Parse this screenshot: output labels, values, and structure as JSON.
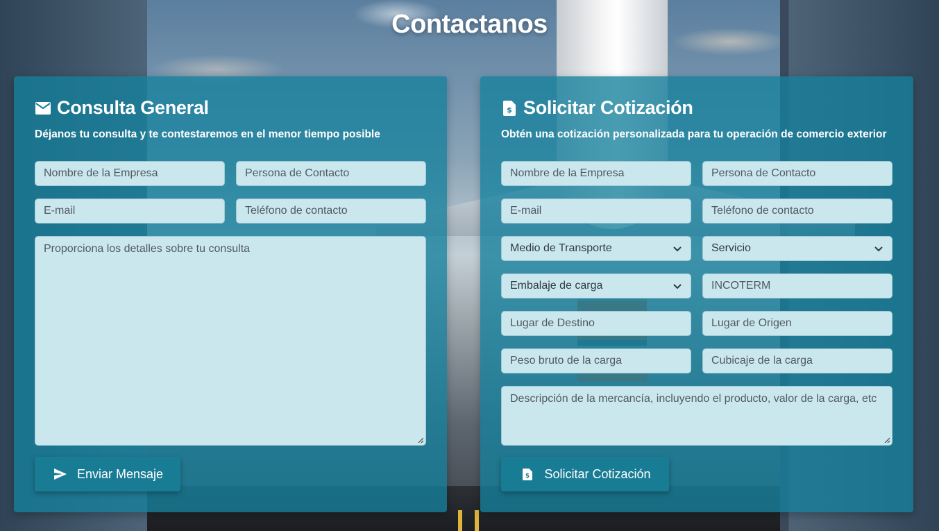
{
  "page": {
    "title": "Contactanos"
  },
  "colors": {
    "card_bg": "#15809c",
    "field_bg": "#cbe7ee",
    "button_bg": "#197c95"
  },
  "general": {
    "icon": "mail-icon",
    "title": "Consulta General",
    "subtitle": "Déjanos tu consulta y te contestaremos en el menor tiempo posible",
    "fields": {
      "company_placeholder": "Nombre de la Empresa",
      "contact_placeholder": "Persona de Contacto",
      "email_placeholder": "E-mail",
      "phone_placeholder": "Teléfono de contacto",
      "message_placeholder": "Proporciona los detalles sobre tu consulta"
    },
    "button": {
      "icon": "send-icon",
      "label": "Enviar Mensaje"
    }
  },
  "quote": {
    "icon": "invoice-dollar-icon",
    "title": "Solicitar Cotización",
    "subtitle": "Obtén una cotización personalizada para tu operación de comercio exterior",
    "fields": {
      "company_placeholder": "Nombre de la Empresa",
      "contact_placeholder": "Persona de Contacto",
      "email_placeholder": "E-mail",
      "phone_placeholder": "Teléfono de contacto",
      "transport_selected": "Medio de Transporte",
      "service_selected": "Servicio",
      "packaging_selected": "Embalaje de carga",
      "incoterm_placeholder": "INCOTERM",
      "destination_placeholder": "Lugar de Destino",
      "origin_placeholder": "Lugar de Origen",
      "weight_placeholder": "Peso bruto de la carga",
      "volume_placeholder": "Cubicaje de la carga",
      "description_placeholder": "Descripción de la mercancía, incluyendo el producto, valor de la carga, etc"
    },
    "button": {
      "icon": "invoice-dollar-icon",
      "label": "Solicitar Cotización"
    }
  }
}
